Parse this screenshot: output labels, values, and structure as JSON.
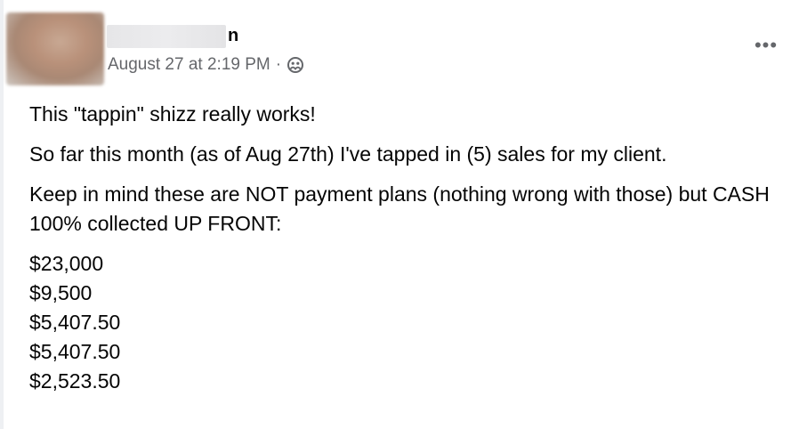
{
  "post": {
    "author_name_visible_tail": "n",
    "timestamp": "August 27 at 2:19 PM",
    "separator": "·",
    "audience_icon": "friends-icon",
    "more_label": "•••",
    "paragraphs": [
      "This \"tappin\" shizz really works!",
      "So far this month (as of Aug 27th) I've tapped in (5) sales for my client.",
      "Keep in mind these are NOT payment plans (nothing wrong with those) but CASH 100% collected UP FRONT:"
    ],
    "amounts": [
      "$23,000",
      "$9,500",
      "$5,407.50",
      "$5,407.50",
      "$2,523.50"
    ]
  },
  "colors": {
    "text_primary": "#050505",
    "text_secondary": "#65676b"
  }
}
